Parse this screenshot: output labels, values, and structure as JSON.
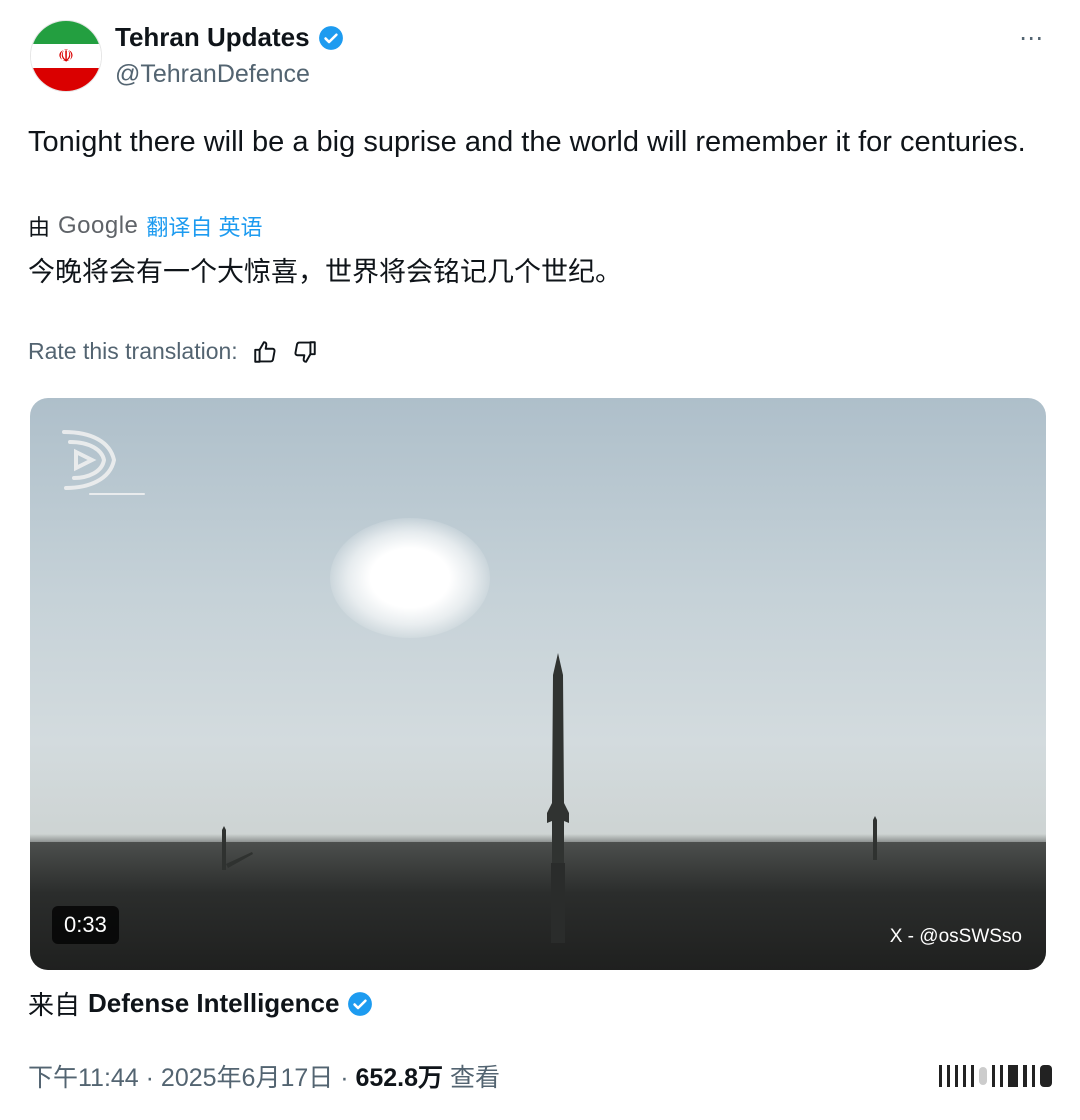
{
  "author": {
    "name": "Tehran Updates",
    "handle": "@TehranDefence",
    "verified": true,
    "avatar": "iran-flag",
    "emblem": "☫"
  },
  "more_icon": "⋯",
  "tweet": {
    "text": "Tonight there will be a big suprise and the world will remember it for centuries.",
    "translated_prefix": "由",
    "translated_service": "Google",
    "translated_suffix": "翻译自 英语",
    "translation": "今晚将会有一个大惊喜，世界将会铭记几个世纪。",
    "rate_label": "Rate this translation:"
  },
  "media": {
    "duration": "0:33",
    "credit": "X - @osSWSso"
  },
  "source": {
    "prefix": "来自",
    "name": "Defense Intelligence",
    "verified": true
  },
  "meta": {
    "time_date": "下午11:44 · 2025年6月17日 · ",
    "views": "652.8万",
    "views_label": " 查看"
  },
  "colors": {
    "accent": "#1d9bf0",
    "text": "#0f1419",
    "secondary": "#536471"
  }
}
